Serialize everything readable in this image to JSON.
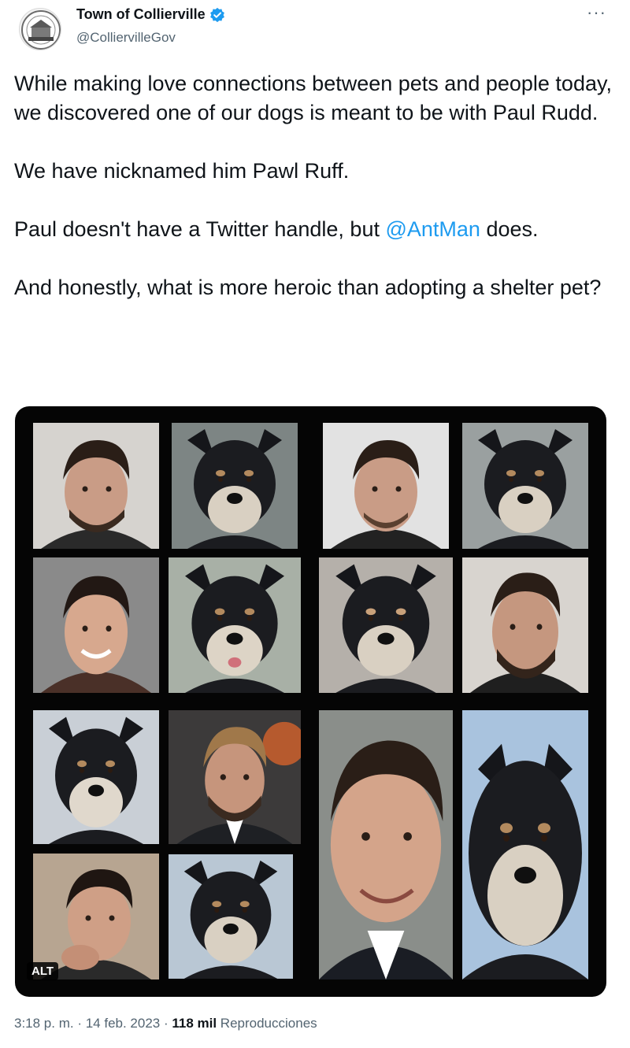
{
  "account": {
    "display_name": "Town of Collierville",
    "handle": "@ColliervilleGov",
    "avatar_icon": "town-seal-icon",
    "verified_icon": "verified-badge-icon",
    "verified_color": "#1d9bf0"
  },
  "menu": {
    "more_label": "···"
  },
  "tweet": {
    "p1": "While making love connections between pets and people today, we discovered one of our dogs is meant to be with Paul Rudd.",
    "p2": "We have nicknamed him Pawl Ruff.",
    "p3_before": "Paul doesn't have a Twitter handle, but ",
    "p3_mention": "@AntMan",
    "p3_after": " does.",
    "p4": "And honestly, what is more heroic than adopting a shelter pet?"
  },
  "media": {
    "alt_label": "ALT",
    "tiles": [
      {
        "kind": "person"
      },
      {
        "kind": "dog"
      },
      {
        "kind": "person"
      },
      {
        "kind": "dog"
      },
      {
        "kind": "person"
      },
      {
        "kind": "dog"
      },
      {
        "kind": "dog"
      },
      {
        "kind": "person"
      },
      {
        "kind": "dog"
      },
      {
        "kind": "person"
      },
      {
        "kind": "person"
      },
      {
        "kind": "dog"
      },
      {
        "kind": "person"
      },
      {
        "kind": "dog"
      }
    ]
  },
  "meta": {
    "time": "3:18 p. m.",
    "sep1": " · ",
    "date": "14 feb. 2023",
    "sep2": " · ",
    "views_count": "118 mil",
    "views_label": " Reproducciones"
  },
  "colors": {
    "text": "#0f1419",
    "secondary": "#536471",
    "link": "#1d9bf0",
    "media_bg": "#050505"
  }
}
